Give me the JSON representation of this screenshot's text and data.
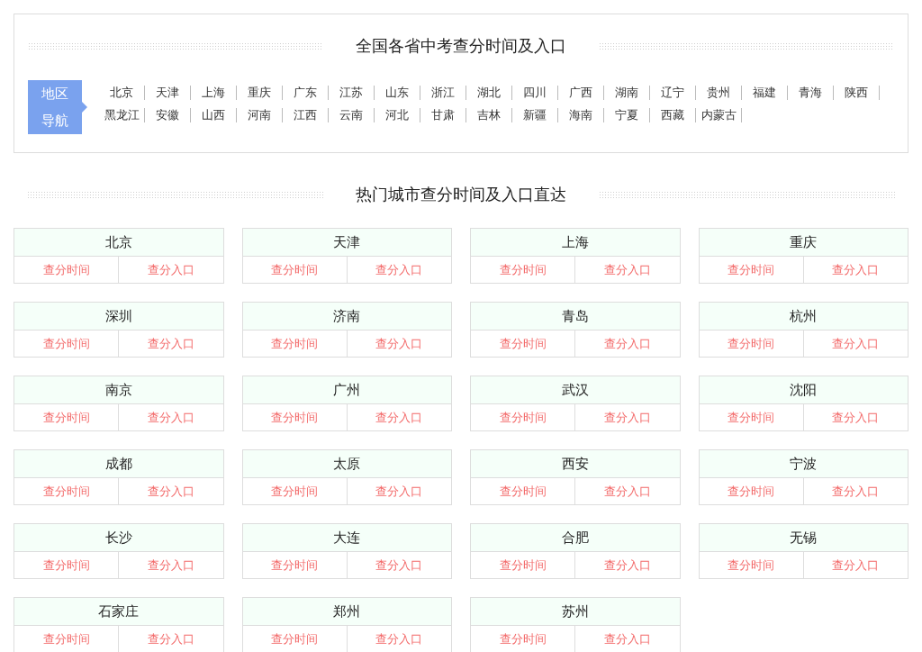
{
  "region_nav": {
    "title": "全国各省中考查分时间及入口",
    "label": "地区导航",
    "rows": [
      [
        "北京",
        "天津",
        "上海",
        "重庆",
        "广东",
        "江苏",
        "山东",
        "浙江",
        "湖北",
        "四川",
        "广西",
        "湖南",
        "辽宁",
        "贵州",
        "福建",
        "青海",
        "陕西"
      ],
      [
        "黑龙江",
        "安徽",
        "山西",
        "河南",
        "江西",
        "云南",
        "河北",
        "甘肃",
        "吉林",
        "新疆",
        "海南",
        "宁夏",
        "西藏",
        "内蒙古"
      ]
    ]
  },
  "hot_cities": {
    "title": "热门城市查分时间及入口直达",
    "cards": [
      {
        "city": "北京",
        "links": [
          "查分时间",
          "查分入口"
        ]
      },
      {
        "city": "天津",
        "links": [
          "查分时间",
          "查分入口"
        ]
      },
      {
        "city": "上海",
        "links": [
          "查分时间",
          "查分入口"
        ]
      },
      {
        "city": "重庆",
        "links": [
          "查分时间",
          "查分入口"
        ]
      },
      {
        "city": "深圳",
        "links": [
          "查分时间",
          "查分入口"
        ]
      },
      {
        "city": "济南",
        "links": [
          "查分时间",
          "查分入口"
        ]
      },
      {
        "city": "青岛",
        "links": [
          "查分时间",
          "查分入口"
        ]
      },
      {
        "city": "杭州",
        "links": [
          "查分时间",
          "查分入口"
        ]
      },
      {
        "city": "南京",
        "links": [
          "查分时间",
          "查分入口"
        ]
      },
      {
        "city": "广州",
        "links": [
          "查分时间",
          "查分入口"
        ]
      },
      {
        "city": "武汉",
        "links": [
          "查分时间",
          "查分入口"
        ]
      },
      {
        "city": "沈阳",
        "links": [
          "查分时间",
          "查分入口"
        ]
      },
      {
        "city": "成都",
        "links": [
          "查分时间",
          "查分入口"
        ]
      },
      {
        "city": "太原",
        "links": [
          "查分时间",
          "查分入口"
        ]
      },
      {
        "city": "西安",
        "links": [
          "查分时间",
          "查分入口"
        ]
      },
      {
        "city": "宁波",
        "links": [
          "查分时间",
          "查分入口"
        ]
      },
      {
        "city": "长沙",
        "links": [
          "查分时间",
          "查分入口"
        ]
      },
      {
        "city": "大连",
        "links": [
          "查分时间",
          "查分入口"
        ]
      },
      {
        "city": "合肥",
        "links": [
          "查分时间",
          "查分入口"
        ]
      },
      {
        "city": "无锡",
        "links": [
          "查分时间",
          "查分入口"
        ]
      },
      {
        "city": "石家庄",
        "links": [
          "查分时间",
          "查分入口"
        ]
      },
      {
        "city": "郑州",
        "links": [
          "查分时间",
          "查分入口"
        ]
      },
      {
        "city": "苏州",
        "links": [
          "查分时间",
          "查分入口"
        ]
      }
    ]
  }
}
